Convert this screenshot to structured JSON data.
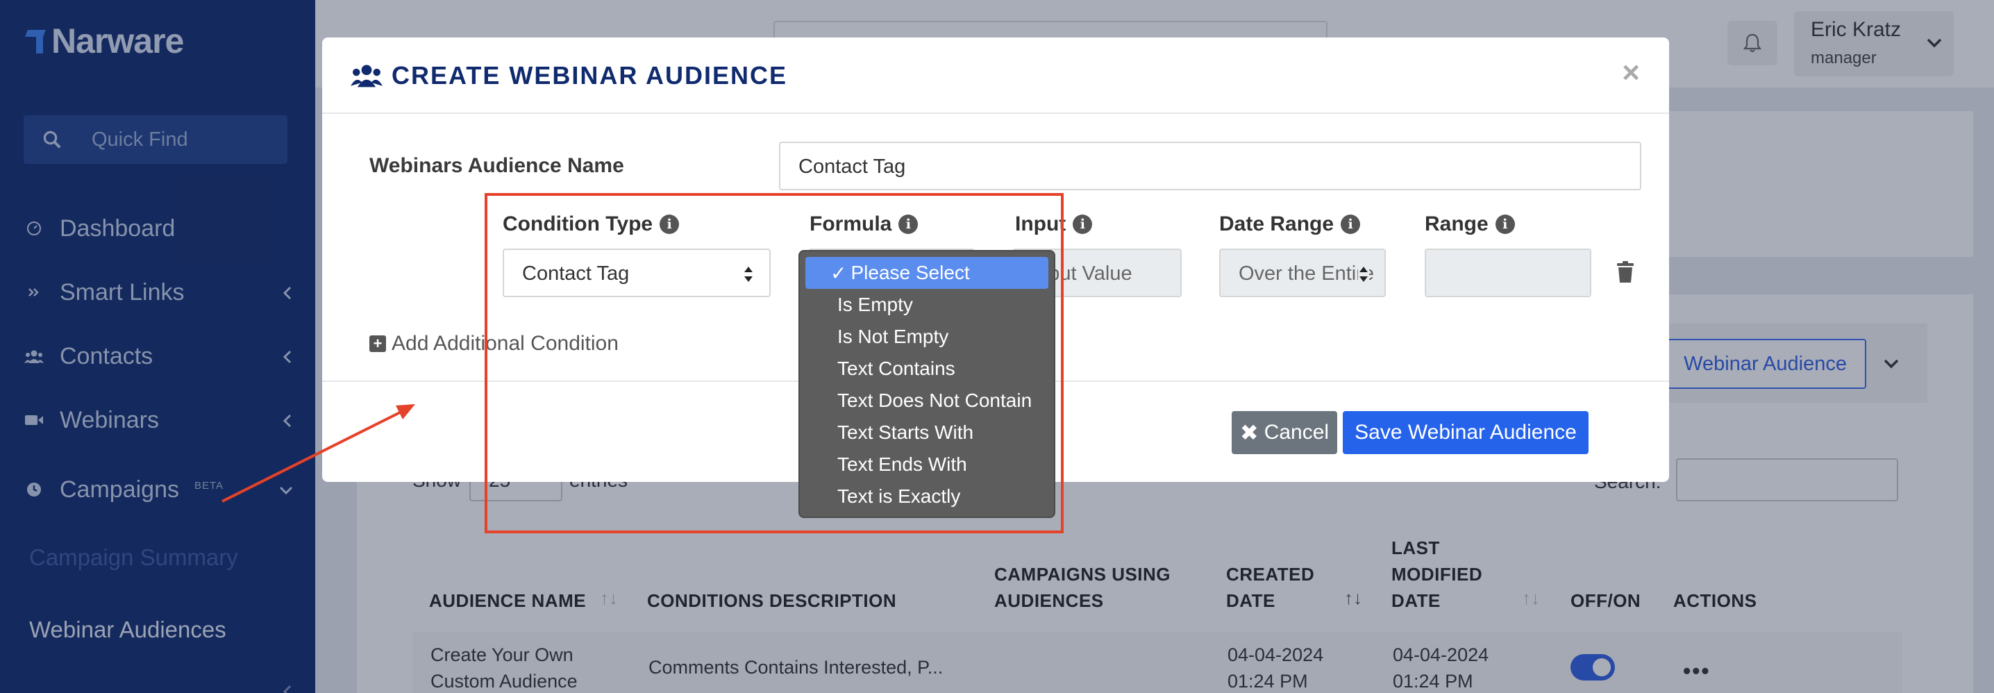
{
  "sidebar": {
    "logo": "Narware",
    "quick_find": "Quick Find",
    "items": [
      {
        "label": "Dashboard",
        "icon": "dashboard-icon"
      },
      {
        "label": "Smart Links",
        "icon": "double-chevron-icon"
      },
      {
        "label": "Contacts",
        "icon": "users-icon"
      },
      {
        "label": "Webinars",
        "icon": "video-icon"
      },
      {
        "label": "Campaigns",
        "icon": "clock-icon",
        "badge": "BETA"
      }
    ],
    "sub_items": [
      "Campaign Summary",
      "Webinar Audiences"
    ]
  },
  "header": {
    "user_name": "Eric Kratz",
    "user_role": "manager"
  },
  "page": {
    "create_button": "Webinar Audience",
    "show_label": "Show",
    "show_value": "25",
    "entries_label": "entries",
    "search_label": "Search:",
    "columns": [
      "AUDIENCE NAME",
      "CONDITIONS DESCRIPTION",
      "CAMPAIGNS USING AUDIENCES",
      "CREATED DATE",
      "LAST MODIFIED DATE",
      "OFF/ON",
      "ACTIONS"
    ],
    "rows": [
      {
        "name": "Create Your Own Custom Audience",
        "conditions": "Comments Contains Interested, P...",
        "created": "04-04-2024 01:24 PM",
        "modified": "04-04-2024 01:24 PM",
        "enabled": true
      }
    ]
  },
  "modal": {
    "title": "CREATE WEBINAR AUDIENCE",
    "name_label": "Webinars Audience Name",
    "name_value": "Contact Tag",
    "condition_type_label": "Condition Type",
    "condition_type_value": "Contact Tag",
    "formula_label": "Formula",
    "input_label": "Input",
    "input_placeholder": "Input Value",
    "date_range_label": "Date Range",
    "date_range_value": "Over the Entire",
    "range_label": "Range",
    "add_condition": "Add Additional Condition",
    "cancel": "Cancel",
    "save": "Save Webinar Audience"
  },
  "formula_dropdown": {
    "selected": "Please Select",
    "options": [
      "Please Select",
      "Is Empty",
      "Is Not Empty",
      "Text Contains",
      "Text Does Not Contain",
      "Text Starts With",
      "Text Ends With",
      "Text is Exactly"
    ]
  },
  "colors": {
    "sidebar": "#0f2a6e",
    "primary": "#2563eb",
    "annotation": "#e5422a"
  }
}
